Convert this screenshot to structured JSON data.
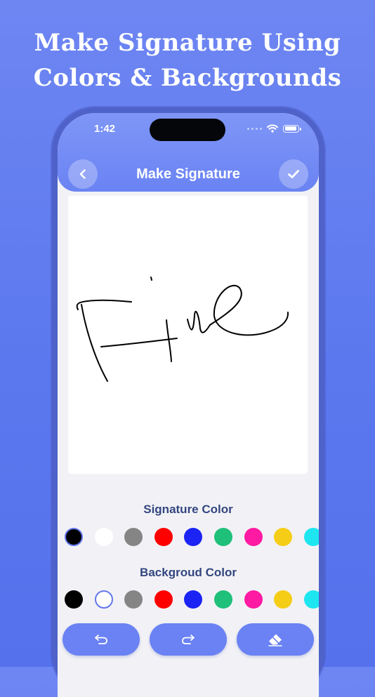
{
  "headline": {
    "line1": "Make Signature Using",
    "line2": "Colors & Backgrounds"
  },
  "status_bar": {
    "time": "1:42"
  },
  "app_bar": {
    "title": "Make Signature",
    "back_icon": "chevron-left-icon",
    "done_icon": "checkmark-icon"
  },
  "canvas": {
    "background": "#ffffff",
    "stroke_color": "#000000",
    "drawn_text": "Fine"
  },
  "signature_color": {
    "label": "Signature Color",
    "selected": "#000000",
    "colors": [
      "#000000",
      "#ffffff",
      "#858585",
      "#ff0000",
      "#1b23f5",
      "#1ec07a",
      "#ff1aa3",
      "#f5cd16",
      "#1ee6f0"
    ]
  },
  "background_color": {
    "label": "Backgroud Color",
    "selected": "#ffffff",
    "colors": [
      "#000000",
      "#ffffff",
      "#858585",
      "#ff0000",
      "#1b23f5",
      "#1ec07a",
      "#ff1aa3",
      "#f5cd16",
      "#1ee6f0"
    ]
  },
  "toolbar": {
    "undo_icon": "undo-icon",
    "redo_icon": "redo-icon",
    "erase_icon": "eraser-icon"
  },
  "colors": {
    "background": "#5b78ee",
    "accent": "#6a82f3",
    "label": "#33467f"
  }
}
